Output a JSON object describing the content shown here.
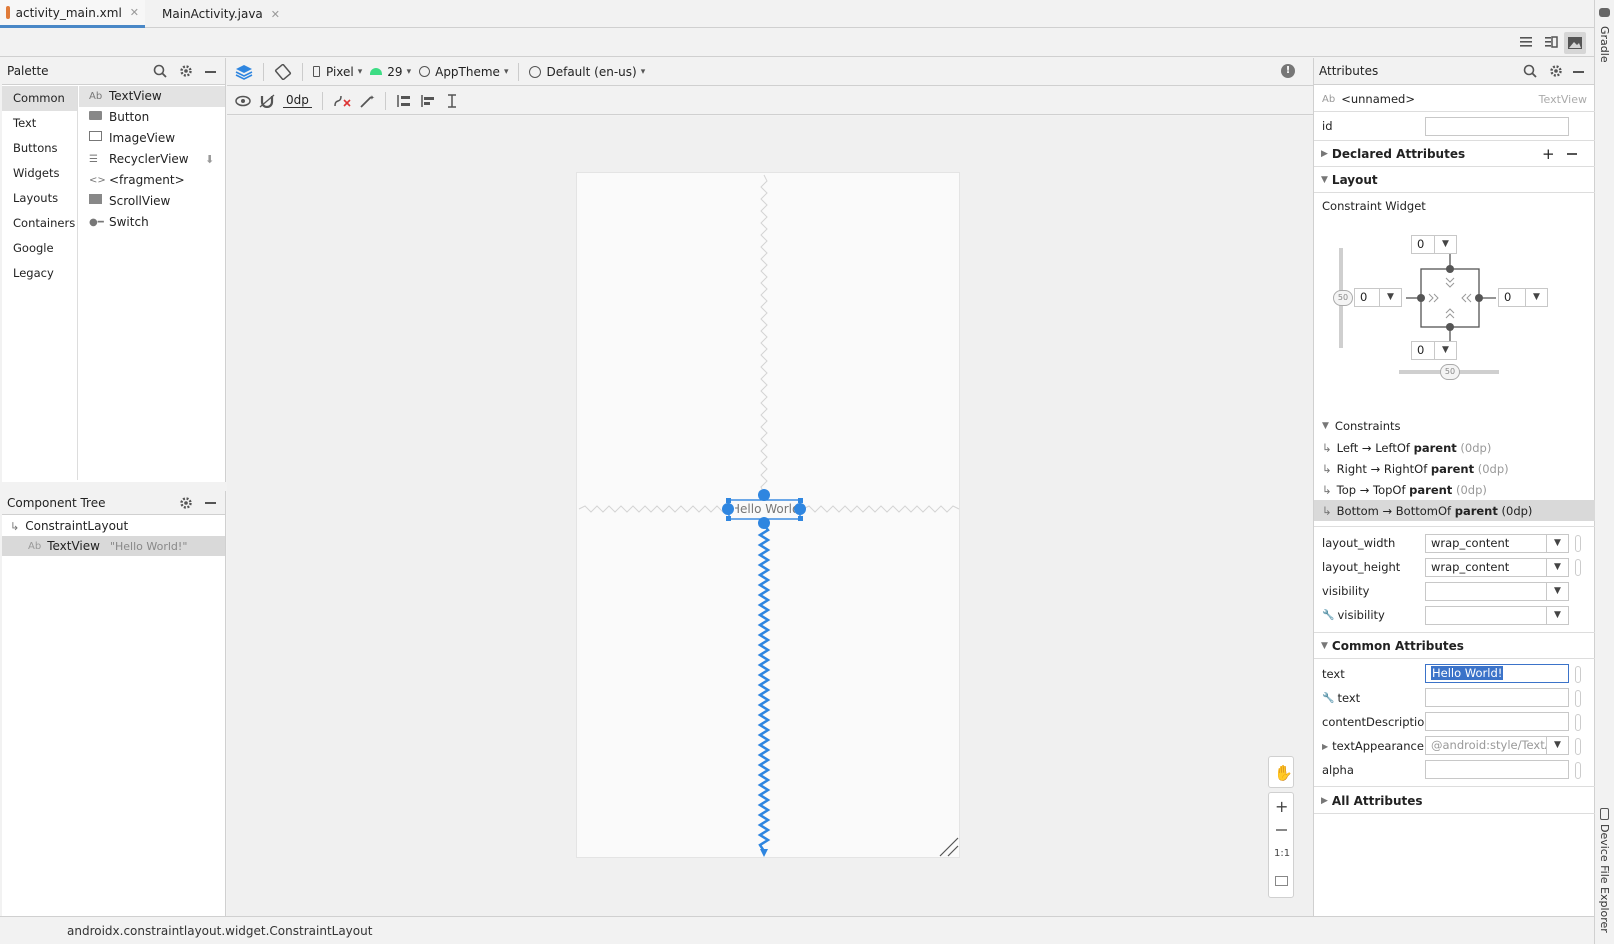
{
  "tabs": [
    {
      "label": "activity_main.xml",
      "active": true
    },
    {
      "label": "MainActivity.java",
      "active": false
    }
  ],
  "right_strip": {
    "gradle": "Gradle",
    "device_explorer": "Device File Explorer"
  },
  "palette": {
    "title": "Palette",
    "categories": [
      "Common",
      "Text",
      "Buttons",
      "Widgets",
      "Layouts",
      "Containers",
      "Google",
      "Legacy"
    ],
    "items": [
      {
        "label": "TextView",
        "icon": "Ab"
      },
      {
        "label": "Button",
        "icon": "button-icon"
      },
      {
        "label": "ImageView",
        "icon": "image-icon"
      },
      {
        "label": "RecyclerView",
        "icon": "list-icon"
      },
      {
        "label": "<fragment>",
        "icon": "code-icon"
      },
      {
        "label": "ScrollView",
        "icon": "scroll-icon"
      },
      {
        "label": "Switch",
        "icon": "switch-icon"
      }
    ]
  },
  "component_tree": {
    "title": "Component Tree",
    "root": "ConstraintLayout",
    "child_label": "TextView",
    "child_value": "\"Hello World!\"",
    "child_icon": "Ab"
  },
  "design_toolbar": {
    "device": "Pixel",
    "api": "29",
    "theme": "AppTheme",
    "locale": "Default (en-us)",
    "margin": "0dp"
  },
  "canvas": {
    "textview_text": "Hello World!",
    "zoom_fit": "1:1"
  },
  "attributes": {
    "title": "Attributes",
    "component_name": "<unnamed>",
    "component_type": "TextView",
    "component_icon": "Ab",
    "id_label": "id",
    "id_value": "",
    "declared": "Declared Attributes",
    "layout": "Layout",
    "constraint_widget": "Constraint Widget",
    "margins": {
      "top": "0",
      "left": "0",
      "right": "0",
      "bottom": "0"
    },
    "bias_v": "50",
    "bias_h": "50",
    "constraints_title": "Constraints",
    "constraints": [
      {
        "lead": "Left → LeftOf ",
        "target": "parent",
        "tail": " (0dp)"
      },
      {
        "lead": "Right → RightOf ",
        "target": "parent",
        "tail": " (0dp)"
      },
      {
        "lead": "Top → TopOf ",
        "target": "parent",
        "tail": " (0dp)"
      },
      {
        "lead": "Bottom → BottomOf ",
        "target": "parent",
        "tail": " (0dp)"
      }
    ],
    "layout_fields": [
      {
        "label": "layout_width",
        "value": "wrap_content",
        "tool": false
      },
      {
        "label": "layout_height",
        "value": "wrap_content",
        "tool": false
      },
      {
        "label": "visibility",
        "value": "",
        "tool": false
      },
      {
        "label": "visibility",
        "value": "",
        "tool": true
      }
    ],
    "common": "Common Attributes",
    "common_fields": [
      {
        "label": "text",
        "value": "Hello World!",
        "tool": false
      },
      {
        "label": "text",
        "value": "",
        "tool": true
      },
      {
        "label": "contentDescription",
        "value": "",
        "tool": false
      },
      {
        "label": "textAppearance",
        "value": "@android:style/TextA",
        "tool": false
      },
      {
        "label": "alpha",
        "value": "",
        "tool": false
      }
    ],
    "all": "All Attributes"
  },
  "status": {
    "text": "androidx.constraintlayout.widget.ConstraintLayout"
  },
  "colors": {
    "accent": "#2f86e0",
    "selection": "#3b73c9"
  }
}
